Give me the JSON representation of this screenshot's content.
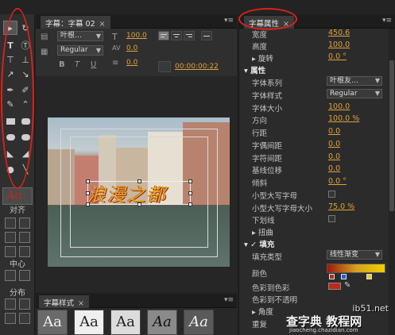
{
  "tools": {
    "align_label": "对齐",
    "center_label": "中心",
    "distribute_label": "分布"
  },
  "title_panel": {
    "tab_label": "字幕：字幕 02",
    "font_family_value": "叶根…",
    "font_style_value": "Regular",
    "font_size_value": "100.0",
    "kerning_value": "0.0",
    "leading_value": "0.0",
    "timecode": "00:00:00:22",
    "title_text": "浪漫之都"
  },
  "styles_panel": {
    "tab_label": "字幕样式",
    "swatches": [
      "Aa",
      "Aa",
      "Aa",
      "Aa",
      "Aa"
    ]
  },
  "props": {
    "tab_label": "字幕属性",
    "rows": {
      "width": {
        "label": "宽度",
        "value": "450.6"
      },
      "height": {
        "label": "高度",
        "value": "100.0"
      },
      "rotation": {
        "label": "旋转",
        "value": "0.0 °"
      },
      "properties_section": "属性",
      "font_family": {
        "label": "字体系列",
        "value": "叶根友…"
      },
      "font_style": {
        "label": "字体样式",
        "value": "Regular"
      },
      "font_size": {
        "label": "字体大小",
        "value": "100.0"
      },
      "aspect": {
        "label": "方向",
        "value": "100.0 %"
      },
      "leading": {
        "label": "行距",
        "value": "0.0"
      },
      "kerning": {
        "label": "字偶间距",
        "value": "0.0"
      },
      "tracking": {
        "label": "字符间距",
        "value": "0.0"
      },
      "baseline": {
        "label": "基线位移",
        "value": "0.0"
      },
      "slant": {
        "label": "倾斜",
        "value": "0.0 °"
      },
      "small_caps": {
        "label": "小型大写字母"
      },
      "small_caps_size": {
        "label": "小型大写字母大小",
        "value": "75.0 %"
      },
      "underline": {
        "label": "下划线"
      },
      "distort": {
        "label": "扭曲"
      },
      "fill_section": "填充",
      "fill_type": {
        "label": "填充类型",
        "value": "线性渐变"
      },
      "color": {
        "label": "颜色"
      },
      "color_stop_color": {
        "label": "色彩到色彩"
      },
      "color_stop_opacity": {
        "label": "色彩到不透明"
      },
      "angle": {
        "label": "角度"
      },
      "repeat": {
        "label": "重复"
      }
    }
  },
  "watermark": {
    "site": "ib51.net",
    "brand": "查字典 教程网",
    "url": "jiaocheng.chazidian.com"
  },
  "colors": {
    "accent_value": "#e0a23a",
    "annotation_red": "#e0201a",
    "gradient_stops": [
      "#9a1a10",
      "#d4a020",
      "#f0d000"
    ],
    "swatch_red": "#c0281c"
  }
}
